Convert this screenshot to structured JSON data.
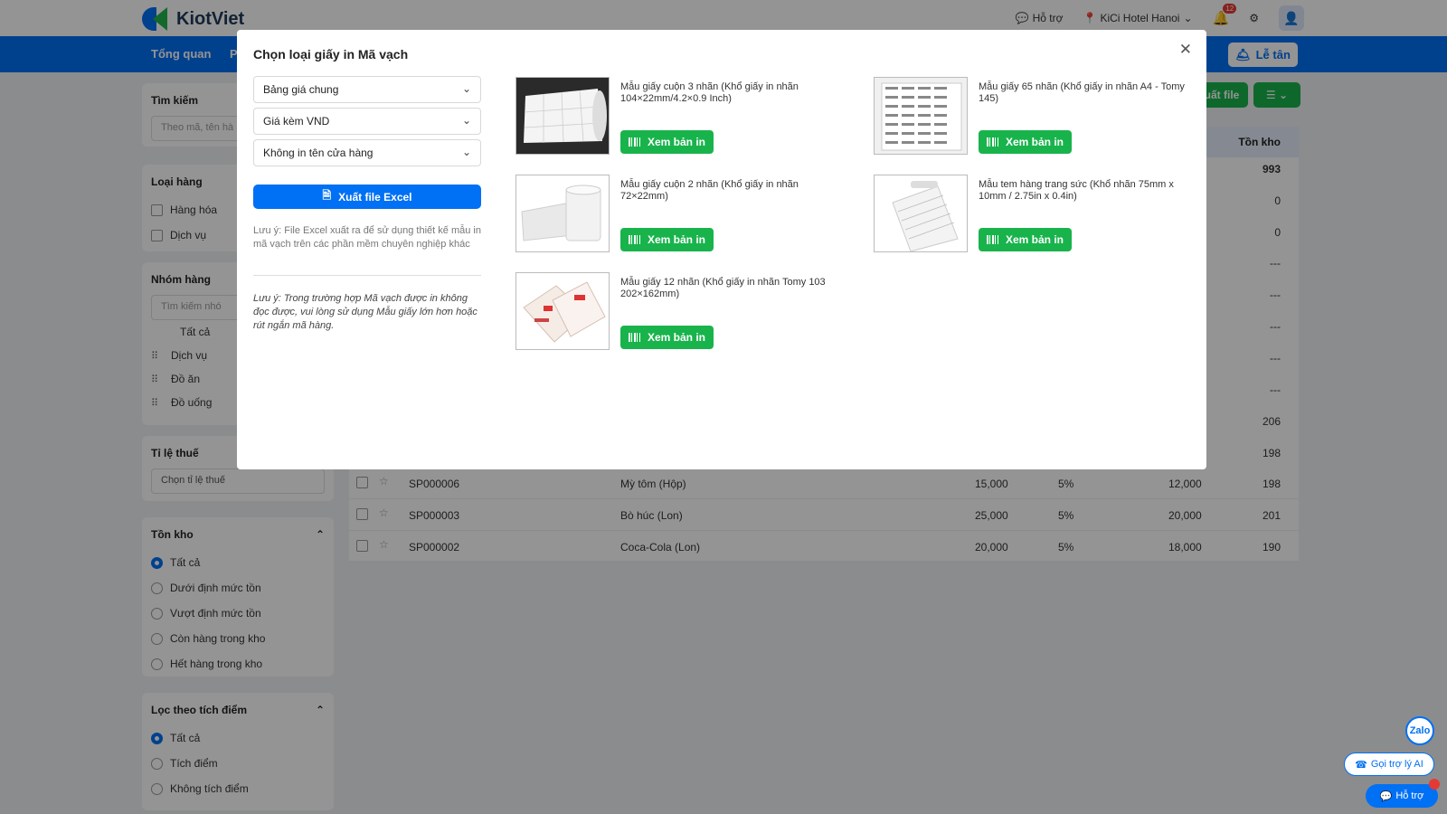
{
  "app": {
    "brand": "KiotViet"
  },
  "topbar": {
    "support_label": "Hỗ trợ",
    "branch_label": "KiCi Hotel Hanoi",
    "notification_count": "12"
  },
  "nav": {
    "items": [
      "Tổng quan",
      "P"
    ],
    "reception_label": "Lễ tân"
  },
  "sidebar": {
    "search_title": "Tìm kiếm",
    "search_placeholder": "Theo mã, tên hà",
    "type_title": "Loại hàng",
    "type_items": [
      "Hàng hóa",
      "Dịch vụ"
    ],
    "group_title": "Nhóm hàng",
    "group_search_placeholder": "Tìm kiếm nhó",
    "group_items": [
      "Tất cả",
      "Dịch vụ",
      "Đồ ăn",
      "Đồ uống"
    ],
    "tax_title": "Tỉ lệ thuế",
    "tax_placeholder": "Chọn tỉ lệ thuế",
    "stock_title": "Tồn kho",
    "stock_items": [
      "Tất cả",
      "Dưới định mức tồn",
      "Vượt định mức tồn",
      "Còn hàng trong kho",
      "Hết hàng trong kho"
    ],
    "points_title": "Lọc theo tích điểm",
    "points_items": [
      "Tất cả",
      "Tích điểm",
      "Không tích điểm"
    ]
  },
  "actions": {
    "export_label": "uất file"
  },
  "table": {
    "stock_header": "Tồn kho",
    "stock_values": [
      "993",
      "0",
      "0",
      "---",
      "---",
      "---",
      "---",
      "---",
      "206",
      "198"
    ],
    "rows": [
      {
        "code": "SP000006",
        "name": "Mỳ tôm (Hộp)",
        "price": "15,000",
        "tax": "5%",
        "cost": "12,000",
        "stock": "198"
      },
      {
        "code": "SP000003",
        "name": "Bò húc (Lon)",
        "price": "25,000",
        "tax": "5%",
        "cost": "20,000",
        "stock": "201"
      },
      {
        "code": "SP000002",
        "name": "Coca-Cola (Lon)",
        "price": "20,000",
        "tax": "5%",
        "cost": "18,000",
        "stock": "190"
      }
    ]
  },
  "modal": {
    "title": "Chọn loại giấy in Mã vạch",
    "select_price": "Bảng giá chung",
    "select_currency": "Giá kèm VND",
    "select_store": "Không in tên cửa hàng",
    "excel_label": "Xuất file Excel",
    "note1": "Lưu ý: File Excel xuất ra để sử dụng thiết kế mẫu in mã vạch trên các phần mềm chuyên nghiệp khác",
    "note2": "Lưu ý: Trong trường hợp Mã vạch được in không đọc được, vui lòng sử dụng Mẫu giấy lớn hơn hoặc rút ngắn mã hàng.",
    "preview_label": "Xem bản in",
    "papers": [
      {
        "title": "Mẫu giấy cuộn 3 nhãn (Khổ giấy in nhãn 104×22mm/4.2×0.9 Inch)"
      },
      {
        "title": "Mẫu giấy 65 nhãn (Khổ giấy in nhãn A4 - Tomy 145)"
      },
      {
        "title": "Mẫu giấy cuộn 2 nhãn (Khổ giấy in nhãn 72×22mm)"
      },
      {
        "title": "Mẫu tem hàng trang sức (Khổ nhãn 75mm x 10mm / 2.75in x 0.4in)"
      },
      {
        "title": "Mẫu giấy 12 nhãn (Khổ giấy in nhãn Tomy 103 202×162mm)"
      }
    ]
  },
  "floating": {
    "zalo": "Zalo",
    "ai_label": "Gọi trợ lý AI",
    "help_label": "Hỗ trợ"
  }
}
